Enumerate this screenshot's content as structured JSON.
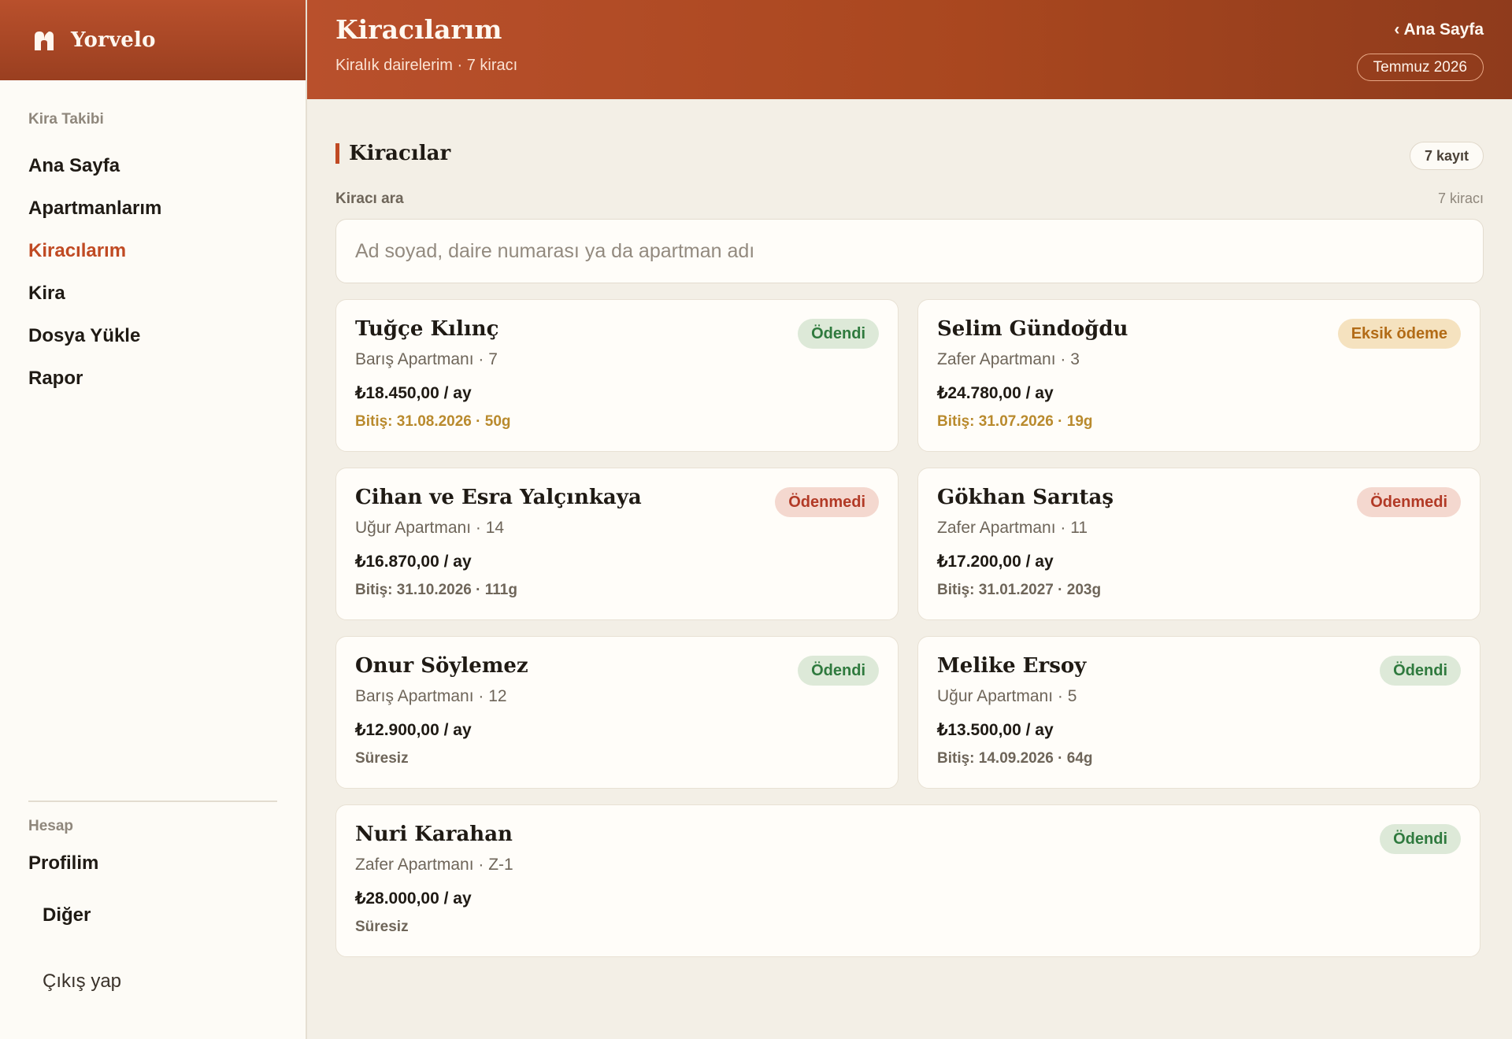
{
  "brand": {
    "name": "Yorvelo",
    "icon": "house-logo-icon"
  },
  "sidebar": {
    "section_tracking": "Kira Takibi",
    "items": [
      {
        "label": "Ana Sayfa"
      },
      {
        "label": "Apartmanlarım"
      },
      {
        "label": "Kiracılarım",
        "active": true
      },
      {
        "label": "Kira"
      },
      {
        "label": "Dosya Yükle"
      },
      {
        "label": "Rapor"
      }
    ],
    "section_account": "Hesap",
    "profile": "Profilim",
    "other": "Diğer",
    "logout": "Çıkış yap"
  },
  "header": {
    "title": "Kiracılarım",
    "subtitle": "Kiralık dairelerim · 7 kiracı",
    "home_link": "‹ Ana Sayfa",
    "month": "Temmuz 2026"
  },
  "main": {
    "section_title": "Kiracılar",
    "record_count": "7 kayıt",
    "search_label": "Kiracı ara",
    "search_count": "7 kiracı",
    "search_placeholder": "Ad soyad, daire numarası ya da apartman adı",
    "search_value": ""
  },
  "tenants": [
    {
      "name": "Tuğçe Kılınç",
      "apartment": "Barış Apartmanı · 7",
      "rent": "₺18.450,00 / ay",
      "end": "Bitiş: 31.08.2026 · 50g",
      "end_soon": true,
      "status": "Ödendi",
      "status_type": "paid"
    },
    {
      "name": "Selim Gündoğdu",
      "apartment": "Zafer Apartmanı · 3",
      "rent": "₺24.780,00 / ay",
      "end": "Bitiş: 31.07.2026 · 19g",
      "end_soon": true,
      "status": "Eksik ödeme",
      "status_type": "partial"
    },
    {
      "name": "Cihan ve Esra Yalçınkaya",
      "apartment": "Uğur Apartmanı · 14",
      "rent": "₺16.870,00 / ay",
      "end": "Bitiş: 31.10.2026 · 111g",
      "end_soon": false,
      "status": "Ödenmedi",
      "status_type": "unpaid"
    },
    {
      "name": "Gökhan Sarıtaş",
      "apartment": "Zafer Apartmanı · 11",
      "rent": "₺17.200,00 / ay",
      "end": "Bitiş: 31.01.2027 · 203g",
      "end_soon": false,
      "status": "Ödenmedi",
      "status_type": "unpaid"
    },
    {
      "name": "Onur Söylemez",
      "apartment": "Barış Apartmanı · 12",
      "rent": "₺12.900,00 / ay",
      "end": "Süresiz",
      "end_soon": false,
      "status": "Ödendi",
      "status_type": "paid"
    },
    {
      "name": "Melike Ersoy",
      "apartment": "Uğur Apartmanı · 5",
      "rent": "₺13.500,00 / ay",
      "end": "Bitiş: 14.09.2026 · 64g",
      "end_soon": false,
      "status": "Ödendi",
      "status_type": "paid"
    },
    {
      "name": "Nuri Karahan",
      "apartment": "Zafer Apartmanı · Z-1",
      "rent": "₺28.000,00 / ay",
      "end": "Süresiz",
      "end_soon": false,
      "status": "Ödendi",
      "status_type": "paid"
    }
  ]
}
